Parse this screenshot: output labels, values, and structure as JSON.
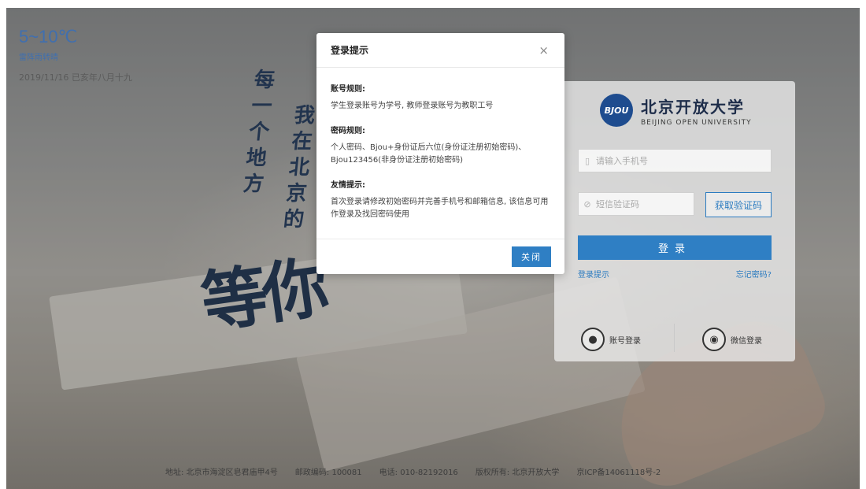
{
  "weather": {
    "temp": "5~10℃",
    "desc": "雷阵雨转晴",
    "date": "2019/11/16 已亥年八月十九"
  },
  "calligraphy": {
    "col1": [
      "每",
      "一",
      "个",
      "地",
      "方"
    ],
    "col2": [
      "我",
      "在",
      "北",
      "京",
      "的"
    ],
    "big": "等你"
  },
  "login": {
    "logo_mark": "BJOU",
    "logo_cn": "北京开放大学",
    "logo_en": "BEIJING OPEN UNIVERSITY",
    "phone_placeholder": "请输入手机号",
    "code_placeholder": "短信验证码",
    "get_code_label": "获取验证码",
    "submit_label": "登录",
    "tip_link": "登录提示",
    "forgot_link": "忘记密码?",
    "account_login": "账号登录",
    "wechat_login": "微信登录"
  },
  "footer": {
    "address": "地址: 北京市海淀区皂君庙甲4号",
    "postcode": "邮政编码: 100081",
    "phone": "电话: 010-82192016",
    "copyright": "版权所有: 北京开放大学",
    "icp": "京ICP备14061118号-2"
  },
  "modal": {
    "title": "登录提示",
    "close_icon": "×",
    "sections": [
      {
        "heading": "账号规则:",
        "text": "学生登录账号为学号, 教师登录账号为教职工号"
      },
      {
        "heading": "密码规则:",
        "text": "个人密码、Bjou+身份证后六位(身份证注册初始密码)、Bjou123456(非身份证注册初始密码)"
      },
      {
        "heading": "友情提示:",
        "text": "首次登录请修改初始密码并完善手机号和邮箱信息, 该信息可用作登录及找回密码使用"
      }
    ],
    "close_button": "关闭"
  },
  "colors": {
    "accent": "#2f7fc4",
    "brand_dark": "#1e4c8f",
    "weather": "#3f6fb0"
  }
}
